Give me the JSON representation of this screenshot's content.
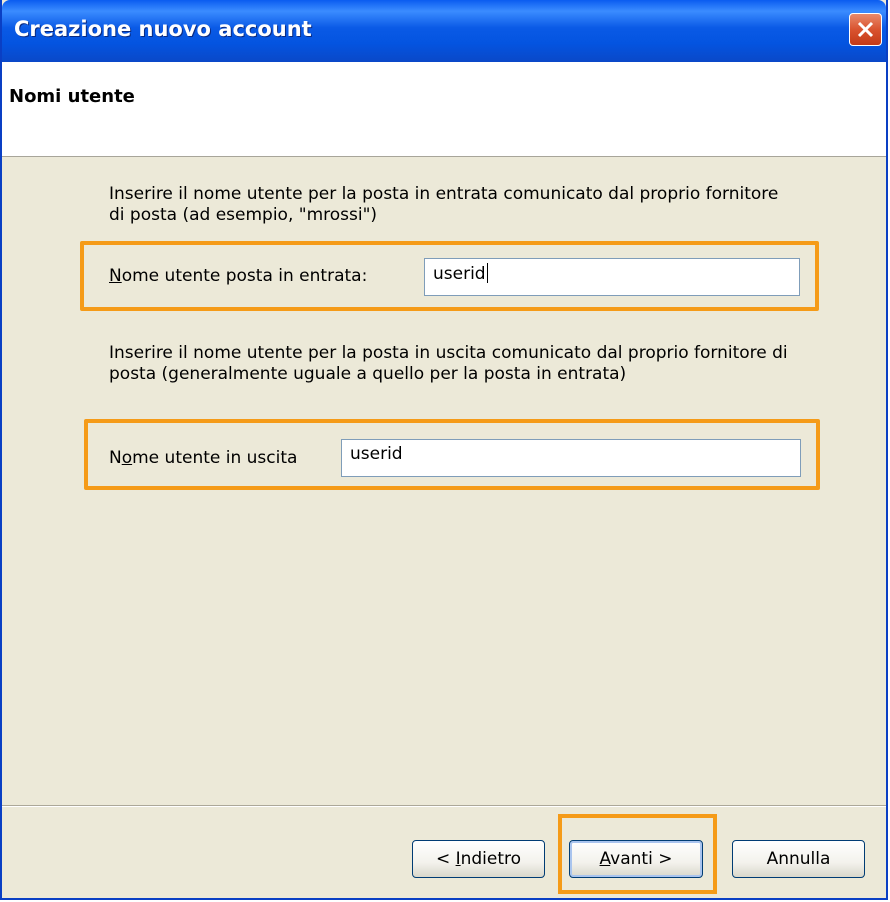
{
  "window": {
    "title": "Creazione nuovo account"
  },
  "header": {
    "title": "Nomi utente"
  },
  "incoming": {
    "description": "Inserire il nome utente per la posta in entrata comunicato dal proprio fornitore di posta (ad esempio, \"mrossi\")",
    "label_prefix": "N",
    "label_rest": "ome utente posta in entrata:",
    "value": "userid"
  },
  "outgoing": {
    "description": "Inserire il nome utente per la posta in uscita comunicato dal proprio fornitore di posta (generalmente uguale a quello per la posta in entrata)",
    "label_start": "N",
    "label_accel": "o",
    "label_rest": "me utente in uscita",
    "value": "userid"
  },
  "buttons": {
    "back_prefix": "< ",
    "back_accel": "I",
    "back_rest": "ndietro",
    "next_accel": "A",
    "next_rest": "vanti >",
    "cancel": "Annulla"
  },
  "colors": {
    "highlight": "#f59b18",
    "titlebar": "#0a5ae6"
  }
}
